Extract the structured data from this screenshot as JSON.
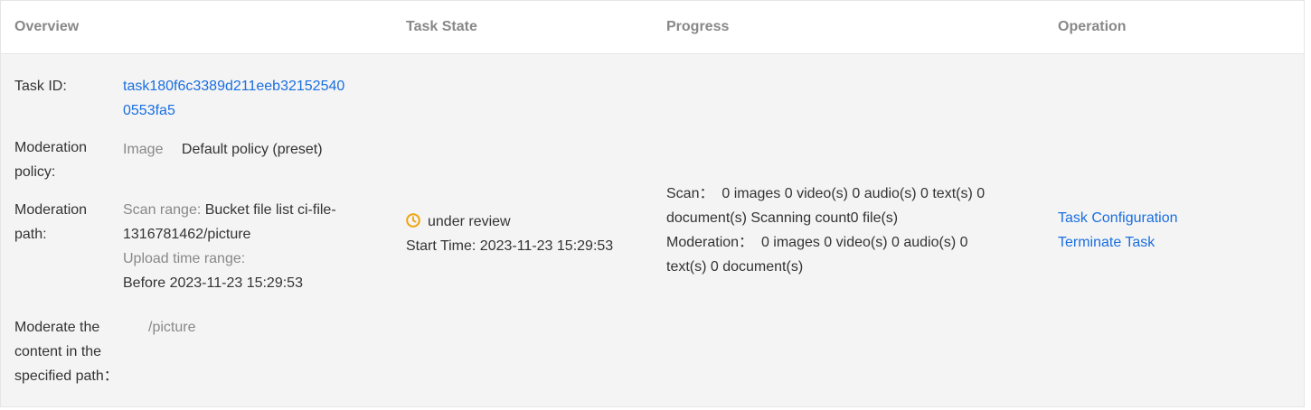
{
  "header": {
    "overview": "Overview",
    "task_state": "Task State",
    "progress": "Progress",
    "operation": "Operation"
  },
  "task": {
    "id_label": "Task ID:",
    "id_line1": "task180f6c3389d211eeb32152540",
    "id_line2": "0553fa5",
    "policy_label_1": "Moderation",
    "policy_label_2": "policy:",
    "policy_type": "Image",
    "policy_value": "Default policy (preset)",
    "path_label_1": "Moderation",
    "path_label_2": "path:",
    "scan_range_label": "Scan range:",
    "scan_range_value_1": "Bucket file list ci-file-",
    "scan_range_value_2": "1316781462/picture",
    "upload_range_label": "Upload time range:",
    "upload_range_value": "Before 2023-11-23 15:29:53",
    "specified_label_1": "Moderate the",
    "specified_label_2": "content in the",
    "specified_label_3": "specified path：",
    "specified_value": "/picture"
  },
  "state": {
    "icon": "clock-icon",
    "status": "under review",
    "start_time": "Start Time: 2023-11-23 15:29:53",
    "icon_color": "#f0a30a"
  },
  "progress": {
    "scan_line1": "Scan：  0 images 0 video(s) 0 audio(s) 0 text(s) 0",
    "scan_line2": "document(s) Scanning count0 file(s)",
    "moderation_line1": "Moderation：  0 images 0 video(s) 0 audio(s) 0",
    "moderation_line2": "text(s) 0 document(s)"
  },
  "operation": {
    "config_label": "Task Configuration",
    "terminate_label": "Terminate Task"
  },
  "colors": {
    "link": "#1a6fe0",
    "muted": "#888888",
    "row_bg": "#f4f4f4"
  }
}
